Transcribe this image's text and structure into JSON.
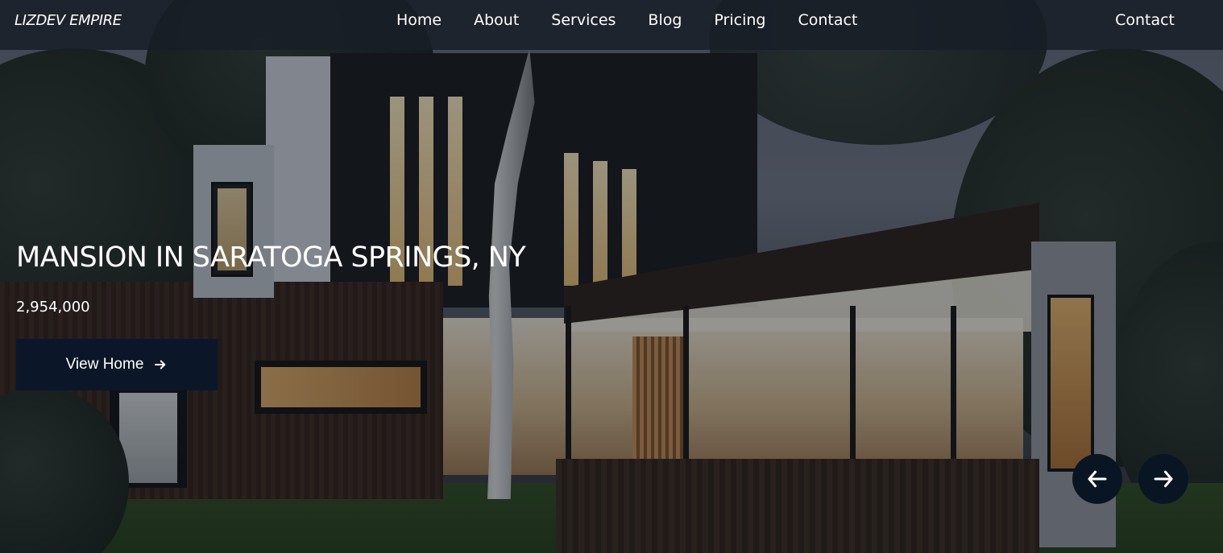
{
  "header": {
    "brand": "LIZDEV EMPIRE",
    "nav_links": [
      "Home",
      "About",
      "Services",
      "Blog",
      "Pricing",
      "Contact"
    ],
    "cta_link": "Contact"
  },
  "hero": {
    "title": "MANSION IN SARATOGA SPRINGS, NY",
    "price": "2,954,000",
    "button_label": "View Home",
    "button_icon": "arrow-right-icon",
    "background_image": "modern-house-at-dusk"
  },
  "carousel": {
    "prev_icon": "arrow-left-icon",
    "next_icon": "arrow-right-icon"
  },
  "colors": {
    "navbar_bg": "#181e28",
    "button_bg": "#0b1728",
    "arrow_bg": "#0a1524",
    "text": "#ffffff"
  }
}
